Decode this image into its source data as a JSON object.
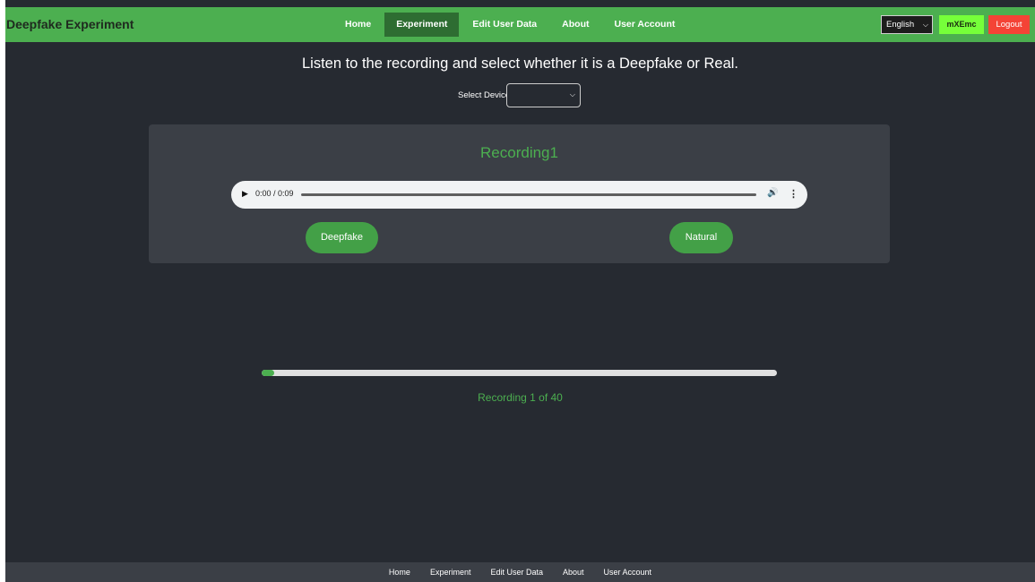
{
  "header": {
    "brand": "Deepfake Experiment",
    "nav": [
      {
        "label": "Home",
        "active": false
      },
      {
        "label": "Experiment",
        "active": true
      },
      {
        "label": "Edit User Data",
        "active": false
      },
      {
        "label": "About",
        "active": false
      },
      {
        "label": "User Account",
        "active": false
      }
    ],
    "language": "English",
    "user": "mXEmc",
    "logout": "Logout"
  },
  "main": {
    "instruction": "Listen to the recording and select whether it is a Deepfake or Real.",
    "device_label": "Select Device",
    "device_value": "",
    "recording_title": "Recording1",
    "audio_time": "0:00 / 0:09",
    "deepfake_label": "Deepfake",
    "natural_label": "Natural",
    "progress_fraction": 0.025,
    "progress_text": "Recording 1 of 40"
  },
  "footer": {
    "nav": [
      "Home",
      "Experiment",
      "Edit User Data",
      "About",
      "User Account"
    ]
  },
  "icons": {
    "play": "play-icon",
    "volume": "volume-icon",
    "more": "more-options-icon",
    "chevron": "chevron-down-icon"
  },
  "colors": {
    "accent": "#4caf50",
    "active_nav": "#2e6d32",
    "user_badge": "#76ff3a",
    "logout": "#f44336",
    "background": "#262a31",
    "card": "#3b3f46"
  }
}
